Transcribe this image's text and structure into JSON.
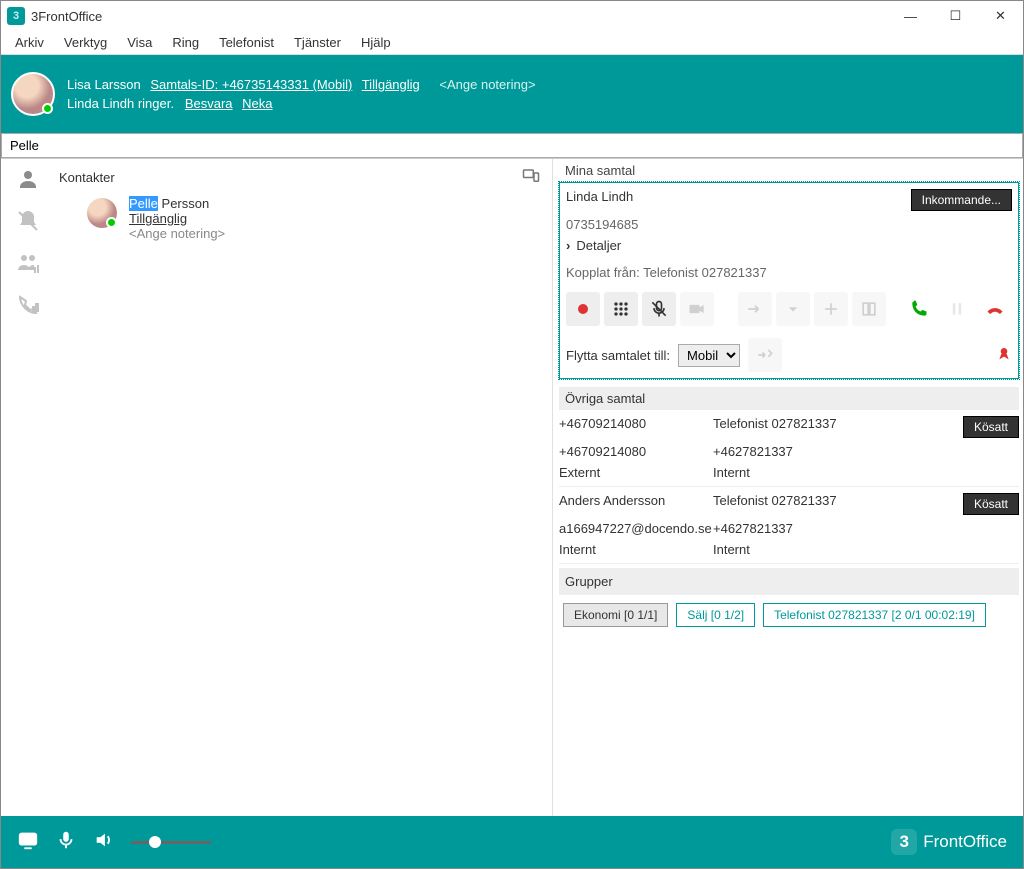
{
  "window": {
    "title": "3FrontOffice"
  },
  "menu": [
    "Arkiv",
    "Verktyg",
    "Visa",
    "Ring",
    "Telefonist",
    "Tjänster",
    "Hjälp"
  ],
  "header": {
    "user": "Lisa Larsson",
    "caller_id": "Samtals-ID: +46735143331 (Mobil)",
    "availability": "Tillgänglig",
    "note_placeholder": "<Ange notering>",
    "ringing": "Linda Lindh ringer.",
    "answer": "Besvara",
    "decline": "Neka"
  },
  "search": {
    "value": "Pelle"
  },
  "contacts": {
    "title": "Kontakter",
    "contact": {
      "first_hl": "Pelle",
      "last": " Persson",
      "status": "Tillgänglig",
      "note": "<Ange notering>"
    }
  },
  "calls": {
    "title": "Mina samtal",
    "caller": "Linda Lindh",
    "number": "0735194685",
    "details": "Detaljer",
    "from": "Kopplat från: Telefonist 027821337",
    "incoming": "Inkommande...",
    "move_label": "Flytta samtalet till:",
    "move_option": "Mobil"
  },
  "other": {
    "title": "Övriga samtal",
    "rows": [
      {
        "a": "+46709214080",
        "b": "Telefonist 027821337",
        "c": "+46709214080",
        "d": "+4627821337",
        "e": "Externt",
        "f": "Internt",
        "badge": "Kösatt"
      },
      {
        "a": "Anders Andersson",
        "b": "Telefonist 027821337",
        "c": "a166947227@docendo.se",
        "d": "+4627821337",
        "e": "Internt",
        "f": "Internt",
        "badge": "Kösatt"
      }
    ]
  },
  "groups": {
    "title": "Grupper",
    "items": [
      "Ekonomi [0 1/1]",
      "Sälj [0 1/2]",
      "Telefonist 027821337 [2 0/1  00:02:19]"
    ]
  },
  "footer": {
    "brand": "FrontOffice"
  }
}
